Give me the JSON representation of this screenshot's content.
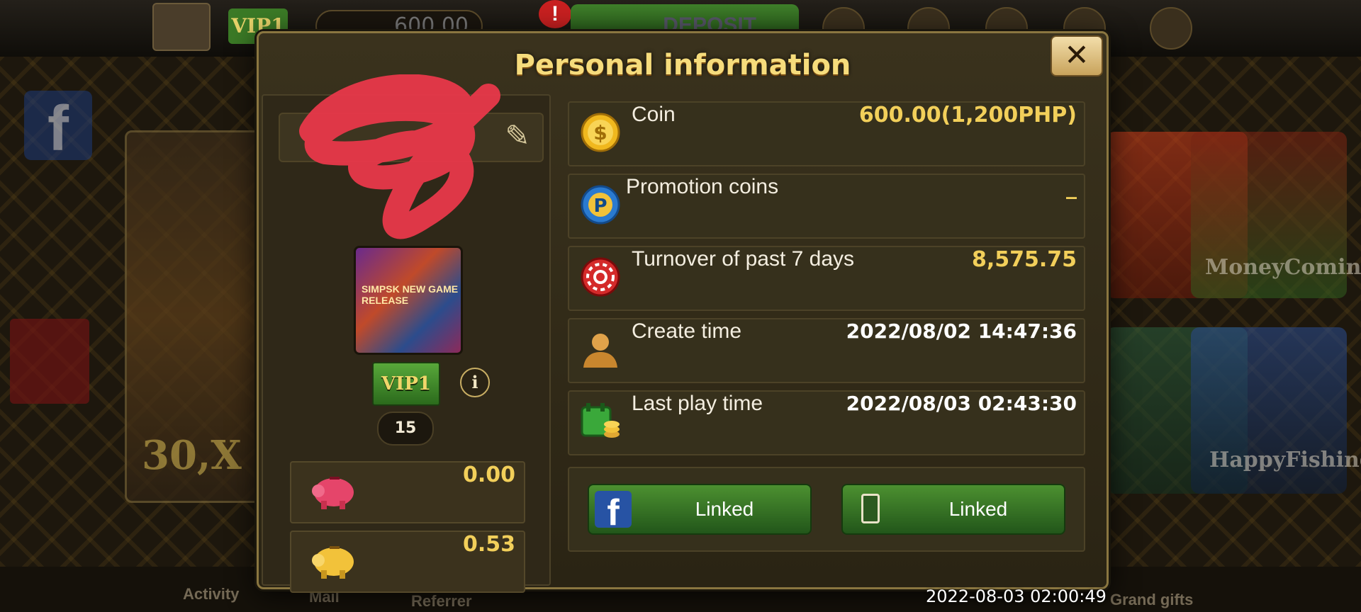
{
  "background": {
    "top_bar": {
      "vip_label": "VIP1",
      "coin_display": "600.00",
      "deposit_label": "DEPOSIT"
    },
    "games": [
      "MoneyComin",
      "HappyFishing"
    ],
    "bottom_nav": [
      "Activity",
      "Mail",
      "Referrer",
      "Grand gifts"
    ]
  },
  "modal": {
    "title": "Personal information",
    "close_label": "✕",
    "profile": {
      "vip_label": "VIP1",
      "info_label": "i",
      "level": "15",
      "avatar_caption": "SIMPSK NEW GAME RELEASE",
      "piggy_bank_red_value": "0.00",
      "piggy_bank_gold_value": "0.53"
    },
    "rows": [
      {
        "label": "Coin",
        "value": "600.00(1,200PHP)",
        "icon": "gold-coin-icon"
      },
      {
        "label": "Promotion coins",
        "value": "_",
        "icon": "promotion-coin-icon"
      },
      {
        "label": "Turnover of past 7 days",
        "value": "8,575.75",
        "icon": "chip-icon"
      },
      {
        "label": "Create time",
        "value": "2022/08/02 14:47:36",
        "icon": "user-silhouette-icon"
      },
      {
        "label": "Last play time",
        "value": "2022/08/03 02:43:30",
        "icon": "calendar-coins-icon"
      }
    ],
    "links": {
      "facebook_label": "Linked",
      "phone_label": "Linked"
    }
  },
  "timestamp": "2022-08-03 02:00:49",
  "colors": {
    "gold": "#f2cf5a",
    "title": "#f6dc7c",
    "green": "#3f7f2a"
  }
}
